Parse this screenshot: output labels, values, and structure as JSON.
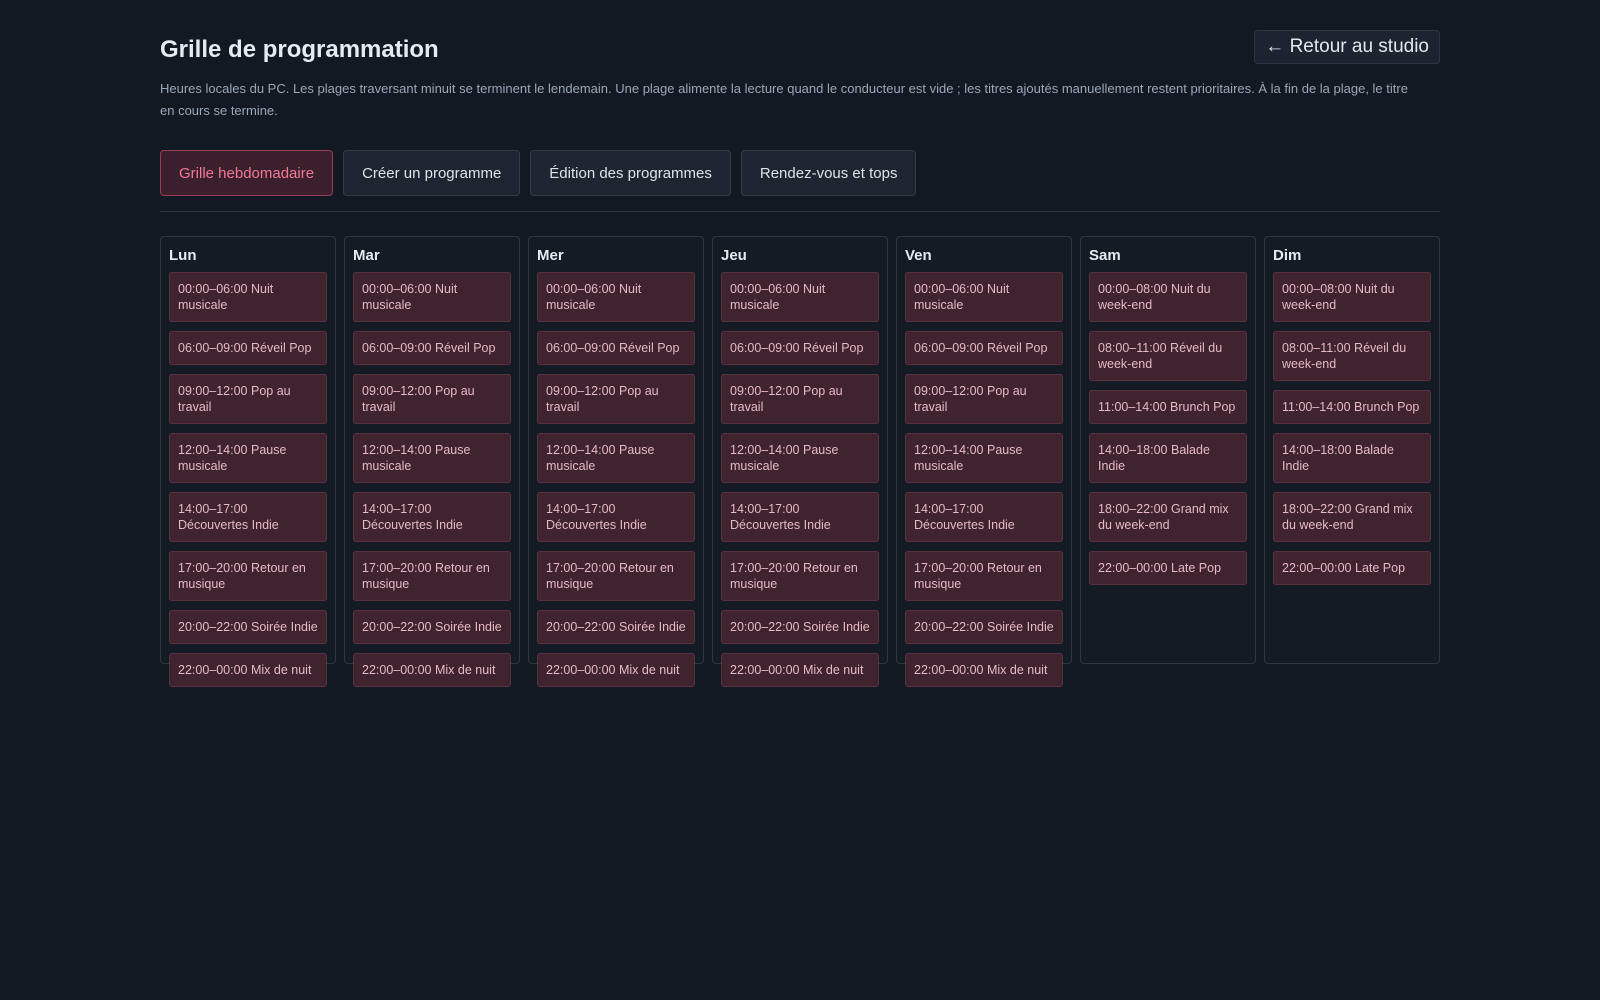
{
  "header": {
    "title": "Grille de programmation",
    "back_label": "← Retour au studio",
    "description": "Heures locales du PC. Les plages traversant minuit se terminent le lendemain. Une plage alimente la lecture quand le conducteur est vide ; les titres ajoutés manuellement restent prioritaires. À la fin de la plage, le titre en cours se termine."
  },
  "tabs": [
    {
      "label": "Grille hebdomadaire",
      "active": true
    },
    {
      "label": "Créer un programme",
      "active": false
    },
    {
      "label": "Édition des programmes",
      "active": false
    },
    {
      "label": "Rendez-vous et tops",
      "active": false
    }
  ],
  "colors": {
    "background": "#121923",
    "accent": "#f37896",
    "slot_background": "#3f232f"
  },
  "days": [
    {
      "name": "Lun",
      "slots": [
        "00:00–06:00 Nuit musicale",
        "06:00–09:00 Réveil Pop",
        "09:00–12:00 Pop au travail",
        "12:00–14:00 Pause musicale",
        "14:00–17:00 Découvertes Indie",
        "17:00–20:00 Retour en musique",
        "20:00–22:00 Soirée Indie",
        "22:00–00:00 Mix de nuit"
      ]
    },
    {
      "name": "Mar",
      "slots": [
        "00:00–06:00 Nuit musicale",
        "06:00–09:00 Réveil Pop",
        "09:00–12:00 Pop au travail",
        "12:00–14:00 Pause musicale",
        "14:00–17:00 Découvertes Indie",
        "17:00–20:00 Retour en musique",
        "20:00–22:00 Soirée Indie",
        "22:00–00:00 Mix de nuit"
      ]
    },
    {
      "name": "Mer",
      "slots": [
        "00:00–06:00 Nuit musicale",
        "06:00–09:00 Réveil Pop",
        "09:00–12:00 Pop au travail",
        "12:00–14:00 Pause musicale",
        "14:00–17:00 Découvertes Indie",
        "17:00–20:00 Retour en musique",
        "20:00–22:00 Soirée Indie",
        "22:00–00:00 Mix de nuit"
      ]
    },
    {
      "name": "Jeu",
      "slots": [
        "00:00–06:00 Nuit musicale",
        "06:00–09:00 Réveil Pop",
        "09:00–12:00 Pop au travail",
        "12:00–14:00 Pause musicale",
        "14:00–17:00 Découvertes Indie",
        "17:00–20:00 Retour en musique",
        "20:00–22:00 Soirée Indie",
        "22:00–00:00 Mix de nuit"
      ]
    },
    {
      "name": "Ven",
      "slots": [
        "00:00–06:00 Nuit musicale",
        "06:00–09:00 Réveil Pop",
        "09:00–12:00 Pop au travail",
        "12:00–14:00 Pause musicale",
        "14:00–17:00 Découvertes Indie",
        "17:00–20:00 Retour en musique",
        "20:00–22:00 Soirée Indie",
        "22:00–00:00 Mix de nuit"
      ]
    },
    {
      "name": "Sam",
      "slots": [
        "00:00–08:00 Nuit du week-end",
        "08:00–11:00 Réveil du week-end",
        "11:00–14:00 Brunch Pop",
        "14:00–18:00 Balade Indie",
        "18:00–22:00 Grand mix du week-end",
        "22:00–00:00 Late Pop"
      ]
    },
    {
      "name": "Dim",
      "slots": [
        "00:00–08:00 Nuit du week-end",
        "08:00–11:00 Réveil du week-end",
        "11:00–14:00 Brunch Pop",
        "14:00–18:00 Balade Indie",
        "18:00–22:00 Grand mix du week-end",
        "22:00–00:00 Late Pop"
      ]
    }
  ]
}
